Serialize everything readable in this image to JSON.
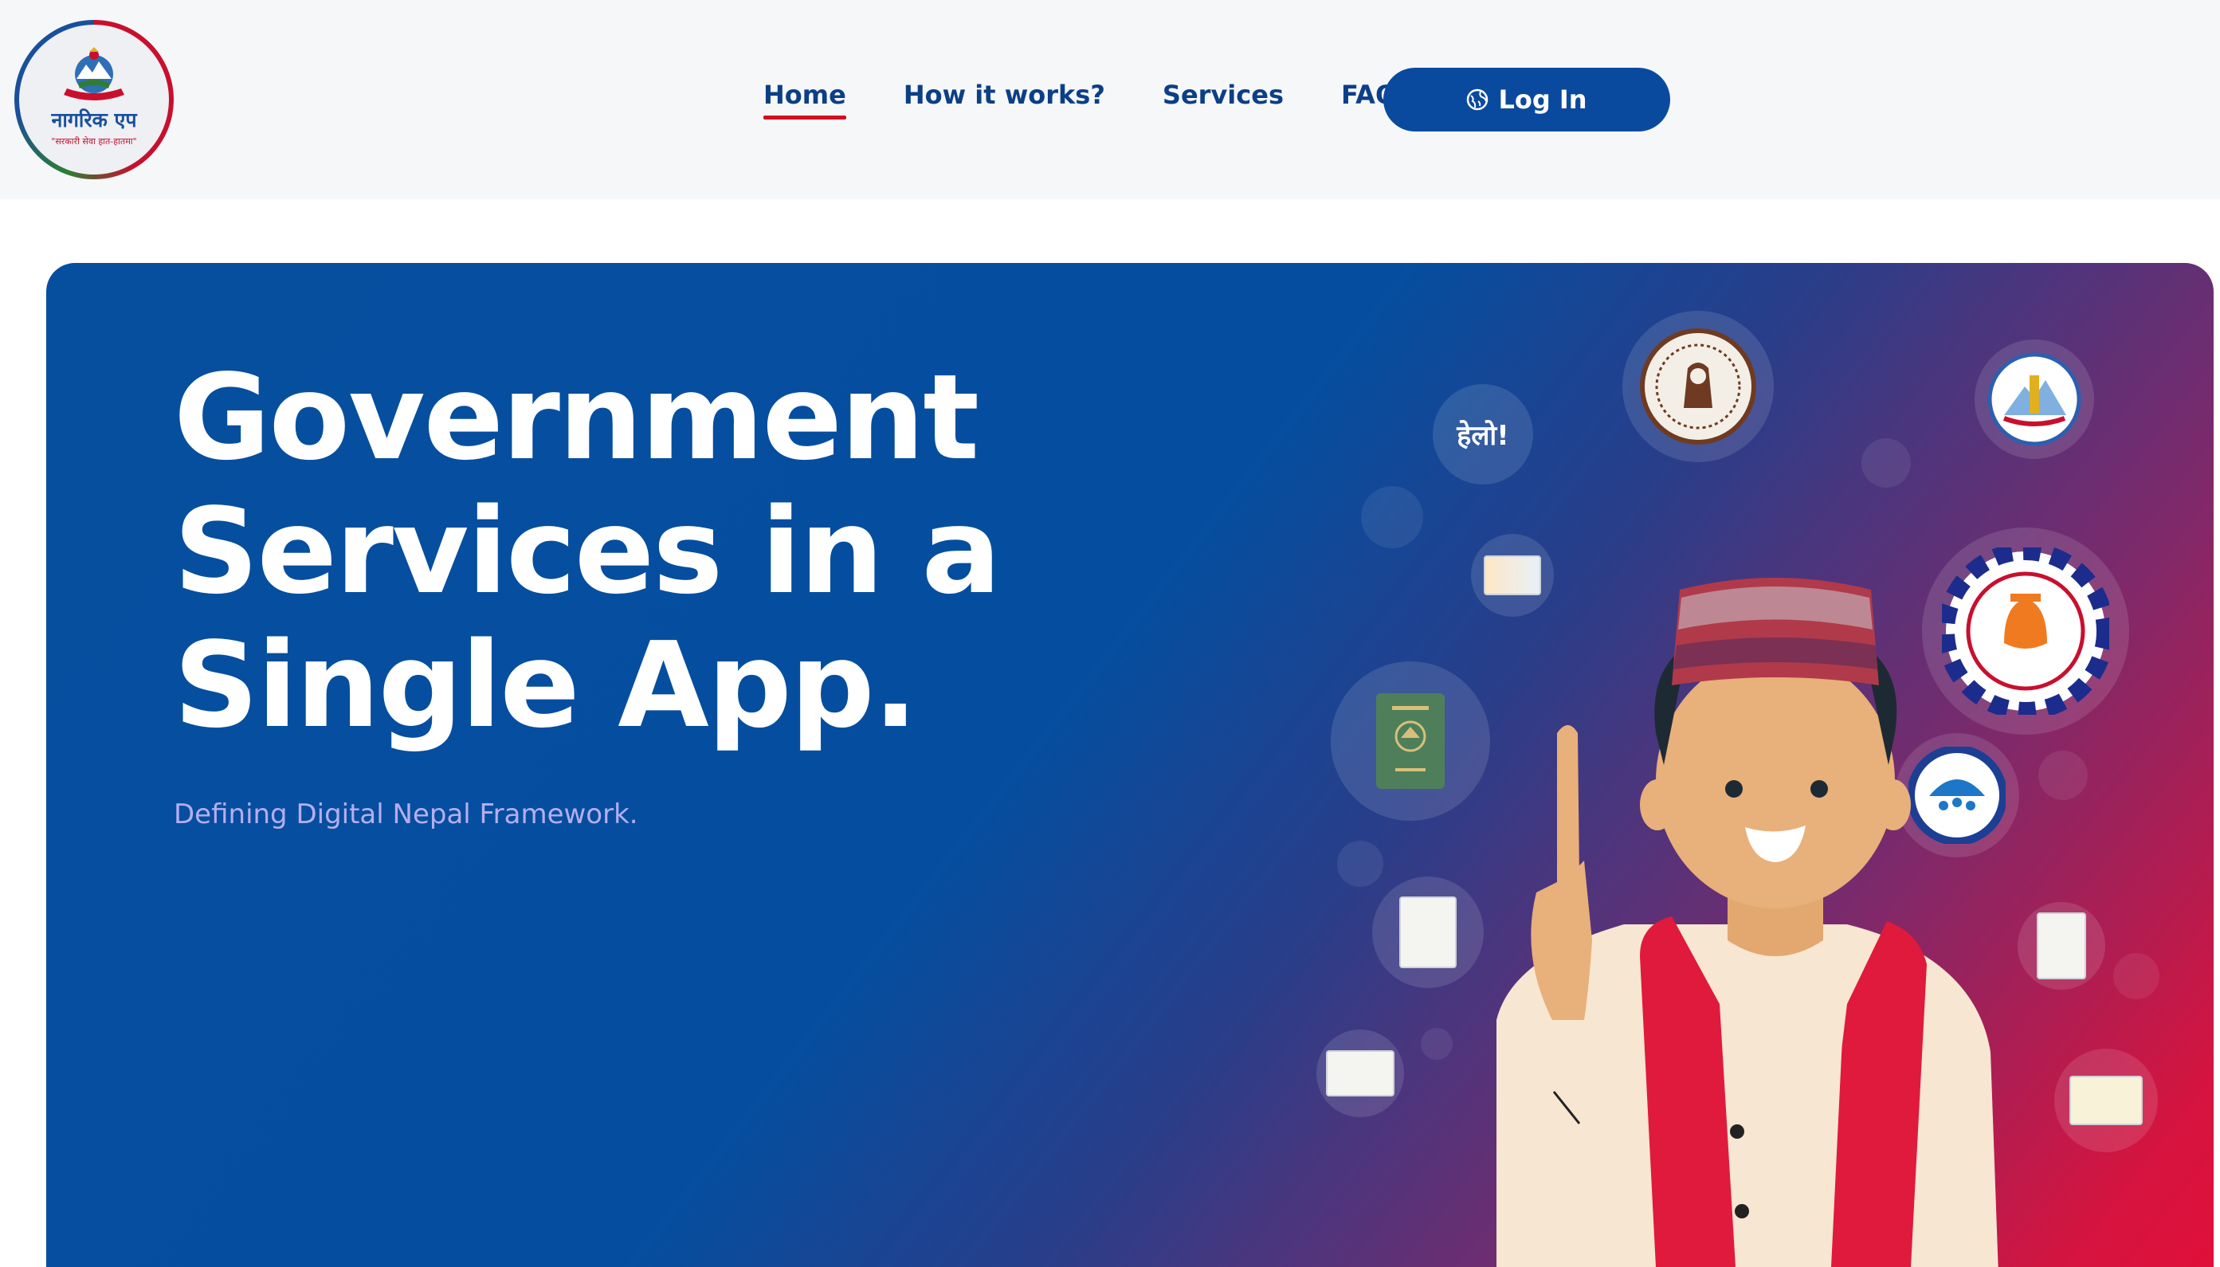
{
  "header": {
    "logo": {
      "title": "नागरिक एप",
      "tagline": "\"सरकारी सेवा हात-हातमा\""
    },
    "nav": [
      {
        "label": "Home",
        "active": true
      },
      {
        "label": "How it works?",
        "active": false
      },
      {
        "label": "Services",
        "active": false
      },
      {
        "label": "FAQS",
        "active": false
      }
    ],
    "login_label": "Log In"
  },
  "hero": {
    "title_lines": [
      "Government",
      "Services in a",
      "Single App."
    ],
    "subtitle": "Defining Digital Nepal Framework.",
    "hello_badge": "हेलो!"
  },
  "colors": {
    "primary": "#0a4a9e",
    "nav_text": "#0b3f86",
    "active_underline": "#d0101f",
    "hero_start": "#054e9f",
    "hero_end": "#e0103a",
    "subtitle": "#b6aef0"
  }
}
